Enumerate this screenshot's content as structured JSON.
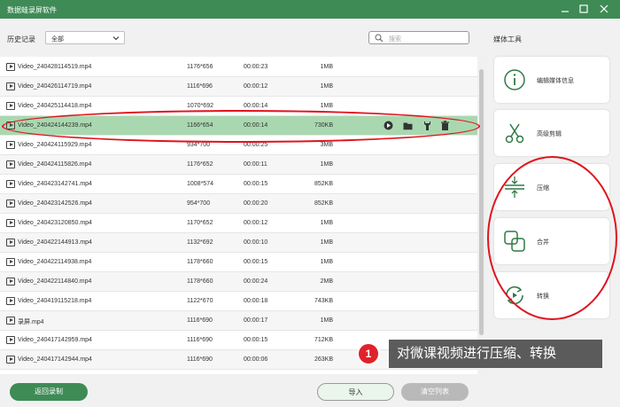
{
  "window": {
    "title": "数据蛙录屏软件"
  },
  "history": {
    "label": "历史记录",
    "filter_value": "全部"
  },
  "search": {
    "placeholder": "搜索"
  },
  "media_tools": {
    "title": "媒体工具",
    "items": [
      {
        "label": "编辑媒体信息",
        "icon": "info-icon"
      },
      {
        "label": "高级剪辑",
        "icon": "scissors-icon"
      },
      {
        "label": "压缩",
        "icon": "compress-icon"
      },
      {
        "label": "合并",
        "icon": "merge-icon"
      },
      {
        "label": "转换",
        "icon": "convert-icon"
      }
    ]
  },
  "files": [
    {
      "name": "Video_240428114519.mp4",
      "res": "1176*656",
      "dur": "00:00:23",
      "size": "1MB"
    },
    {
      "name": "Video_240426114719.mp4",
      "res": "1116*696",
      "dur": "00:00:12",
      "size": "1MB"
    },
    {
      "name": "Video_240425114418.mp4",
      "res": "1070*692",
      "dur": "00:00:14",
      "size": "1MB"
    },
    {
      "name": "Video_240424144239.mp4",
      "res": "1166*654",
      "dur": "00:00:14",
      "size": "730KB"
    },
    {
      "name": "Video_240424115929.mp4",
      "res": "934*700",
      "dur": "00:00:25",
      "size": "3MB"
    },
    {
      "name": "Video_240424115826.mp4",
      "res": "1176*652",
      "dur": "00:00:11",
      "size": "1MB"
    },
    {
      "name": "Video_240423142741.mp4",
      "res": "1008*574",
      "dur": "00:00:15",
      "size": "852KB"
    },
    {
      "name": "Video_240423142526.mp4",
      "res": "954*700",
      "dur": "00:00:20",
      "size": "852KB"
    },
    {
      "name": "Video_240423120850.mp4",
      "res": "1170*652",
      "dur": "00:00:12",
      "size": "1MB"
    },
    {
      "name": "Video_240422144913.mp4",
      "res": "1132*692",
      "dur": "00:00:10",
      "size": "1MB"
    },
    {
      "name": "Video_240422114938.mp4",
      "res": "1178*660",
      "dur": "00:00:15",
      "size": "1MB"
    },
    {
      "name": "Video_240422114840.mp4",
      "res": "1178*660",
      "dur": "00:00:24",
      "size": "2MB"
    },
    {
      "name": "Video_240419115218.mp4",
      "res": "1122*670",
      "dur": "00:00:18",
      "size": "743KB"
    },
    {
      "name": "录屏.mp4",
      "res": "1116*690",
      "dur": "00:00:17",
      "size": "1MB"
    },
    {
      "name": "Video_240417142959.mp4",
      "res": "1116*690",
      "dur": "00:00:15",
      "size": "712KB"
    },
    {
      "name": "Video_240417142944.mp4",
      "res": "1116*690",
      "dur": "00:00:06",
      "size": "263KB"
    }
  ],
  "selected_index": 3,
  "buttons": {
    "back": "返回录制",
    "import": "导入",
    "clear": "清空列表"
  },
  "annotation": {
    "number": "1",
    "text": "对微课视频进行压缩、转换"
  },
  "colors": {
    "brand": "#3e8b56",
    "selected_row": "#a9d8b0",
    "annotation_red": "#e0141e"
  }
}
